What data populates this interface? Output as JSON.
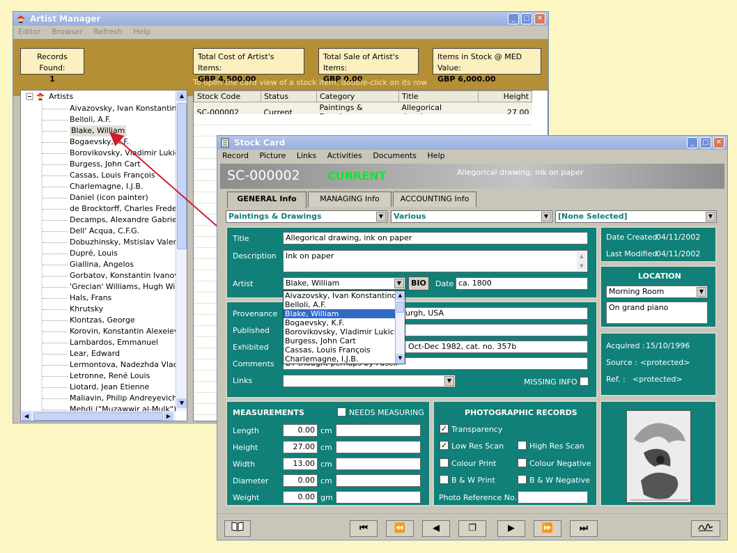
{
  "artist_manager": {
    "title": "Artist Manager",
    "menu": [
      "Editor",
      "Browser",
      "Refresh",
      "Help"
    ],
    "records_found_label": "Records Found:",
    "records_found_value": "1",
    "total_cost_label": "Total Cost of Artist's Items:",
    "total_cost_value": "GBP  4,500.00",
    "total_sale_label": "Total Sale of Artist's Items:",
    "total_sale_value": "GBP  0.00",
    "stock_value_label": "Items in Stock @ MED Value:",
    "stock_value_value": "GBP  6,000.00",
    "hint": "To open the card view of a stock item, double-click on its row",
    "tree_root": "Artists",
    "artists": [
      "Aivazovsky, Ivan Konstantinovich",
      "Belloli, A.F.",
      "Blake, William",
      "Bogaevsky, K.F.",
      "Borovikovsky, Vladimir Lukich",
      "Burgess, John Cart",
      "Cassas, Louis François",
      "Charlemagne, I.J.B.",
      "Daniel (icon painter)",
      "de Brocktorff, Charles Frederick",
      "Decamps, Alexandre Gabriel",
      "Dell' Acqua, C.F.G.",
      "Dobuzhinsky, Mstislav Valerianovich",
      "Dupré, Louis",
      "Giallina, Angelos",
      "Gorbatov, Konstantin Ivanovich",
      "'Grecian' Williams, Hugh William",
      "Hals, Frans",
      "Khrutsky",
      "Klontzas, George",
      "Korovin, Konstantin Alexeievich",
      "Lambardos, Emmanuel",
      "Lear, Edward",
      "Lermontova, Nadezhda Vladimirovna",
      "Letronne, René Louis",
      "Liotard, Jean Etienne",
      "Maliavin, Philip Andreyevich",
      "Mehdi (\"Muzawwir al-Mulk\")"
    ],
    "grid_headers": [
      "Stock Code",
      "Status",
      "Category",
      "Title",
      "Height"
    ],
    "grid_rows": [
      [
        "SC-000002",
        "Current",
        "Paintings & Drawings",
        "Allegorical drawing...",
        "27.00"
      ]
    ]
  },
  "stock_card": {
    "title": "Stock Card",
    "menu": [
      "Record",
      "Picture",
      "Links",
      "Activities",
      "Documents",
      "Help"
    ],
    "code": "SC-000002",
    "status": "CURRENT",
    "header_title": "Allegorical drawing, ink on paper",
    "tabs": [
      "GENERAL Info",
      "MANAGING Info",
      "ACCOUNTING Info"
    ],
    "category": "Paintings & Drawings",
    "subcategory": "Various",
    "other": "[None Selected]",
    "title_label": "Title",
    "title_value": "Allegorical drawing, ink on paper",
    "description_label": "Description",
    "description_value": "Ink on paper",
    "artist_label": "Artist",
    "artist_value": "Blake, William",
    "bio_label": "BIO",
    "date_label": "Date",
    "date_value": "ca. 1800",
    "artist_dropdown": [
      "Aivazovsky, Ivan Konstantinovich",
      "Belloli, A.F.",
      "Blake, William",
      "Bogaevsky, K.F.",
      "Borovikovsky, Vladimir Lukich",
      "Burgess, John Cart",
      "Cassas, Louis François",
      "Charlemagne, I.J.B."
    ],
    "provenance_label": "Provenance",
    "provenance_value": "urgh, USA",
    "published_label": "Published",
    "exhibited_label": "Exhibited",
    "exhibited_value": "g, Oct-Dec 1982, cat. no. 357b",
    "comments_label": "Comments",
    "comments_value": "BT thought perhaps by Fuseli",
    "links_label": "Links",
    "missing_info_label": "MISSING INFO",
    "date_created_label": "Date Created",
    "date_created_value": "04/11/2002",
    "last_modified_label": "Last Modified",
    "last_modified_value": "04/11/2002",
    "location_header": "LOCATION",
    "location_value": "Morning Room",
    "location_note": "On grand piano",
    "acquired_label": "Acquired :",
    "acquired_value": "15/10/1996",
    "source_label": "Source :",
    "source_value": "<protected>",
    "ref_label": "Ref. :",
    "ref_value": "<protected>",
    "measurements_header": "MEASUREMENTS",
    "needs_measuring_label": "NEEDS MEASURING",
    "measurements": [
      {
        "label": "Length",
        "value": "0.00",
        "unit": "cm"
      },
      {
        "label": "Height",
        "value": "27.00",
        "unit": "cm"
      },
      {
        "label": "Width",
        "value": "13.00",
        "unit": "cm"
      },
      {
        "label": "Diameter",
        "value": "0.00",
        "unit": "cm"
      },
      {
        "label": "Weight",
        "value": "0.00",
        "unit": "gm"
      }
    ],
    "photo_header": "PHOTOGRAPHIC RECORDS",
    "photo": {
      "transparency": "Transparency",
      "low_res": "Low Res Scan",
      "high_res": "High Res Scan",
      "colour_print": "Colour Print",
      "colour_negative": "Colour Negative",
      "bw_print": "B & W  Print",
      "bw_negative": "B & W  Negative",
      "ref_no": "Photo Reference No."
    },
    "nav_buttons": [
      "⏮",
      "⏪",
      "◀",
      "❐",
      "▶",
      "⏩",
      "⏭"
    ]
  }
}
